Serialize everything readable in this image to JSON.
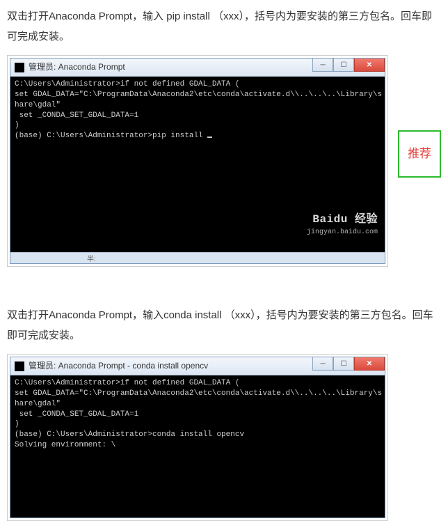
{
  "section1": {
    "desc": "双击打开Anaconda Prompt，输入 pip install （xxx），括号内为要安装的第三方包名。回车即可完成安装。",
    "titlebar": "管理员: Anaconda Prompt",
    "term": {
      "l1": "C:\\Users\\Administrator>if not defined GDAL_DATA (",
      "l2": "set GDAL_DATA=\"C:\\ProgramData\\Anaconda2\\etc\\conda\\activate.d\\\\..\\..\\..\\Library\\s",
      "l3": "hare\\gdal\"",
      "l4": " set _CONDA_SET_GDAL_DATA=1",
      "l5": ")",
      "l6": "",
      "l7": "(base) C:\\Users\\Administrator>pip install "
    },
    "statusbar_text": "半:",
    "watermark_top": "Baidu 经验",
    "watermark_sub": "jingyan.baidu.com"
  },
  "recommend_label": "推荐",
  "section2": {
    "desc": "双击打开Anaconda Prompt，输入conda install （xxx），括号内为要安装的第三方包名。回车即可完成安装。",
    "titlebar": "管理员: Anaconda Prompt - conda  install opencv",
    "term": {
      "l1": "C:\\Users\\Administrator>if not defined GDAL_DATA (",
      "l2": "set GDAL_DATA=\"C:\\ProgramData\\Anaconda2\\etc\\conda\\activate.d\\\\..\\..\\..\\Library\\s",
      "l3": "hare\\gdal\"",
      "l4": " set _CONDA_SET_GDAL_DATA=1",
      "l5": ")",
      "l6": "",
      "l7": "(base) C:\\Users\\Administrator>conda install opencv",
      "l8": "Solving environment: \\"
    }
  },
  "window_controls": {
    "minimize": "─",
    "maximize": "☐",
    "close": "✕"
  }
}
